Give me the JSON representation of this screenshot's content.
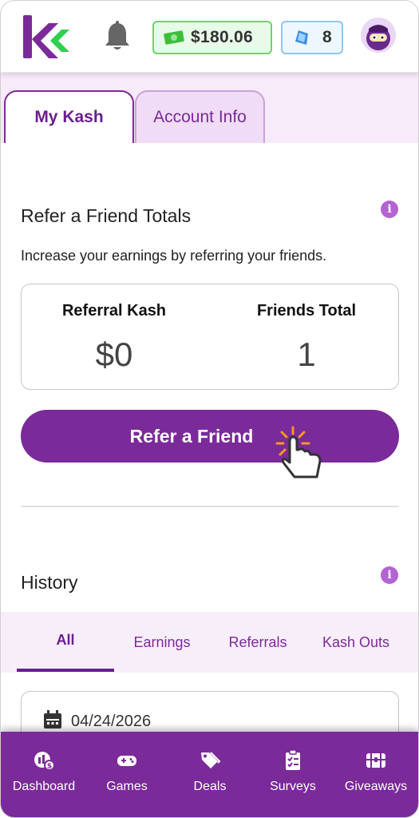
{
  "header": {
    "balance": "$180.06",
    "gems": "8",
    "colors": {
      "brand_purple": "#7b2a99",
      "brand_green": "#2fcf4f"
    },
    "icons": [
      "kashkick-logo-icon",
      "bell-icon",
      "cash-icon",
      "gem-icon",
      "avatar-icon"
    ]
  },
  "tabs": [
    {
      "label": "My Kash",
      "active": true
    },
    {
      "label": "Account Info",
      "active": false
    }
  ],
  "refer": {
    "title": "Refer a Friend Totals",
    "subtitle": "Increase your earnings by referring your friends.",
    "referral_kash_label": "Referral Kash",
    "referral_kash_value": "$0",
    "friends_total_label": "Friends Total",
    "friends_total_value": "1",
    "button_label": "Refer a Friend"
  },
  "history": {
    "title": "History",
    "tabs": [
      {
        "label": "All",
        "active": true
      },
      {
        "label": "Earnings",
        "active": false
      },
      {
        "label": "Referrals",
        "active": false
      },
      {
        "label": "Kash Outs",
        "active": false
      }
    ],
    "entries": [
      {
        "date": "04/24/2026"
      }
    ]
  },
  "bottom_nav": [
    {
      "label": "Dashboard",
      "icon": "dashboard-icon"
    },
    {
      "label": "Games",
      "icon": "gamepad-icon"
    },
    {
      "label": "Deals",
      "icon": "tag-icon"
    },
    {
      "label": "Surveys",
      "icon": "clipboard-icon"
    },
    {
      "label": "Giveaways",
      "icon": "treasure-chest-icon"
    }
  ]
}
